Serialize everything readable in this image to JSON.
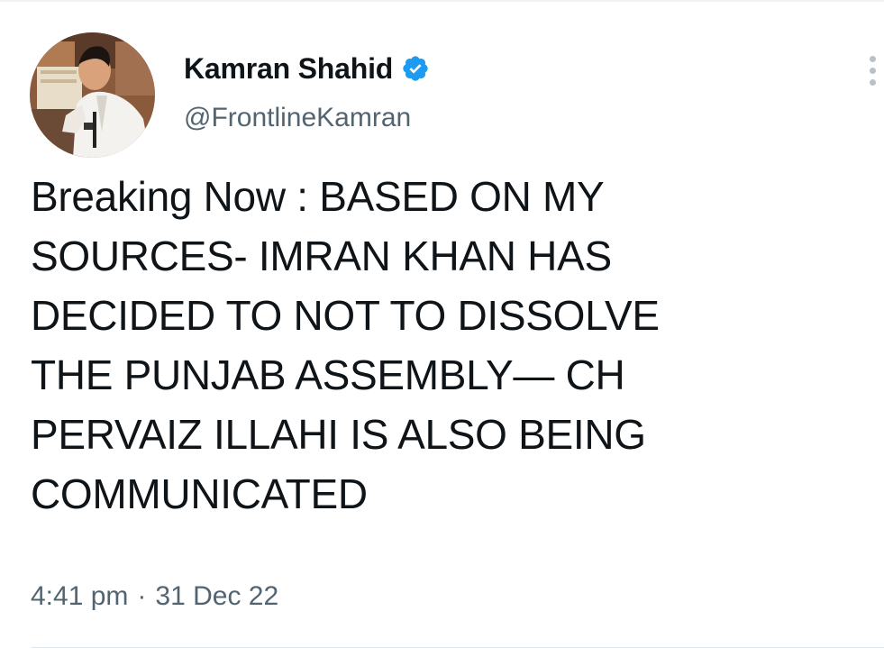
{
  "author": {
    "display_name": "Kamran Shahid",
    "handle": "@FrontlineKamran",
    "verified": true,
    "avatar_icon": "profile-photo"
  },
  "tweet": {
    "text": "Breaking Now : BASED ON MY\nSOURCES- IMRAN KHAN HAS\nDECIDED TO NOT TO DISSOLVE\nTHE PUNJAB ASSEMBLY— CH\nPERVAIZ ILLAHI IS ALSO BEING\nCOMMUNICATED",
    "time": "4:41 pm",
    "separator": "·",
    "date": "31 Dec 22"
  },
  "icons": {
    "verified": "verified-badge-icon",
    "more": "more-options-icon"
  },
  "colors": {
    "verified_blue": "#1d9bf0",
    "text_primary": "#0f1419",
    "text_secondary": "#536471",
    "divider": "#e1e8ed"
  }
}
